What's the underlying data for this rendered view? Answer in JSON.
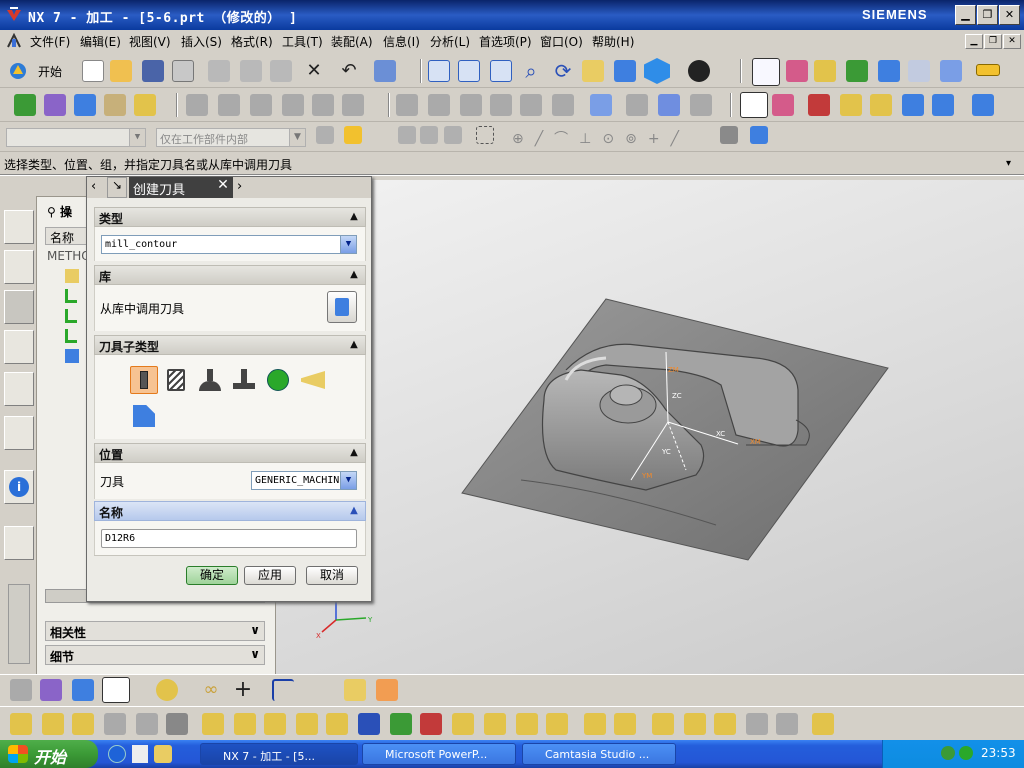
{
  "window": {
    "title": "NX 7 - 加工 - [5-6.prt （修改的） ]",
    "brand": "SIEMENS"
  },
  "menu": [
    "文件(F)",
    "编辑(E)",
    "视图(V)",
    "插入(S)",
    "格式(R)",
    "工具(T)",
    "装配(A)",
    "信息(I)",
    "分析(L)",
    "首选项(P)",
    "窗口(O)",
    "帮助(H)"
  ],
  "toolbar": {
    "start_label": "开始",
    "filter_placeholder": "",
    "scope_select": "仅在工作部件内部"
  },
  "prompt": "选择类型、位置、组，并指定刀具名或从库中调用刀具",
  "nav": {
    "header_label": "操",
    "column_name": "名称",
    "root_label": "METHO",
    "related_label": "相关性",
    "details_label": "细节"
  },
  "dialog": {
    "title": "创建刀具",
    "sections": {
      "type": "类型",
      "library": "库",
      "subtype": "刀具子类型",
      "location": "位置",
      "name": "名称"
    },
    "type_value": "mill_contour",
    "library_text": "从库中调用刀具",
    "tool_label": "刀具",
    "tool_value": "GENERIC_MACHIN",
    "name_value": "D12R6",
    "ok": "确定",
    "apply": "应用",
    "cancel": "取消"
  },
  "viewport": {
    "csys_labels": [
      "ZM",
      "ZC",
      "YC",
      "XM",
      "XC",
      "YM"
    ],
    "triad_labels": [
      "Z",
      "X",
      "Y"
    ]
  },
  "taskbar": {
    "start": "开始",
    "tasks": [
      "NX 7 - 加工 - [5...",
      "Microsoft PowerP...",
      "Camtasia Studio ..."
    ],
    "clock": "23:53"
  },
  "colors": {
    "title_blue": "#0a246a",
    "taskbar_blue": "#245edb",
    "start_green": "#3b9a36",
    "highlight_orange": "#f29d52"
  }
}
